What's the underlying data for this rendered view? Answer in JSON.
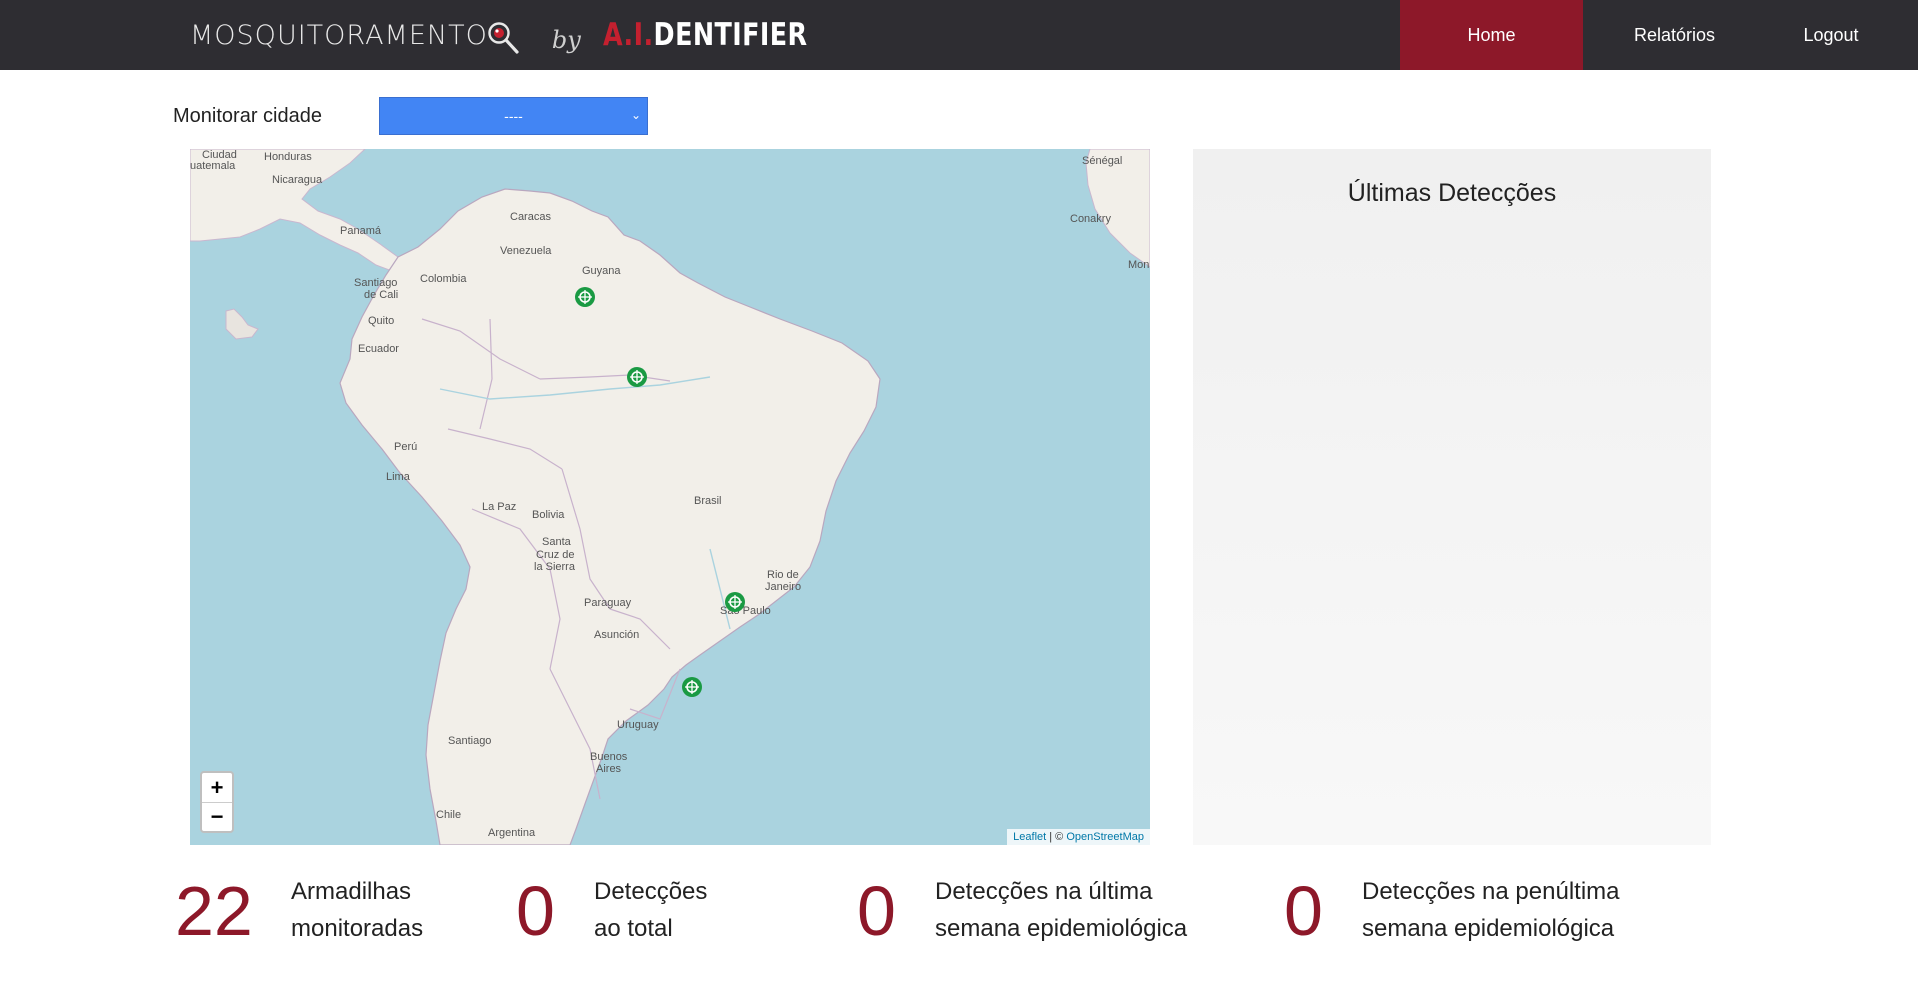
{
  "nav": {
    "brand_name": "MOSQUITORAMENTO",
    "brand_by": "by",
    "brand_logo_red": "A.I.",
    "brand_logo_white": "DENTIFIER",
    "items": [
      {
        "label": "Home",
        "active": true
      },
      {
        "label": "Relatórios",
        "active": false
      },
      {
        "label": "Logout",
        "active": false
      }
    ]
  },
  "filter": {
    "label": "Monitorar cidade",
    "selected": "----"
  },
  "map": {
    "zoom_in": "+",
    "zoom_out": "−",
    "attribution_leaflet": "Leaflet",
    "attribution_sep": " | © ",
    "attribution_osm": "OpenStreetMap",
    "marker_count": 4,
    "places": {
      "ciudad": "Ciudad",
      "guatemala": "uatemala",
      "honduras": "Honduras",
      "nicaragua": "Nicaragua",
      "panama": "Panamá",
      "caracas": "Caracas",
      "venezuela": "Venezuela",
      "guyana": "Guyana",
      "santiago_cali_1": "Santiago",
      "santiago_cali_2": "de Cali",
      "colombia": "Colombia",
      "quito": "Quito",
      "ecuador": "Ecuador",
      "peru": "Perú",
      "lima": "Lima",
      "lapaz": "La Paz",
      "bolivia": "Bolivia",
      "santacruz_1": "Santa",
      "santacruz_2": "Cruz de",
      "santacruz_3": "la Sierra",
      "brasil": "Brasil",
      "rio_1": "Rio de",
      "rio_2": "Janeiro",
      "saopaulo": "São Paulo",
      "paraguay": "Paraguay",
      "asuncion": "Asunción",
      "uruguay": "Uruguay",
      "buenosaires_1": "Buenos",
      "buenosaires_2": "Aires",
      "santiago": "Santiago",
      "chile": "Chile",
      "argentina": "Argentina",
      "senegal": "Sénégal",
      "conakry": "Conakry",
      "mon": "Mon"
    }
  },
  "detections_panel": {
    "title": "Últimas Detecções"
  },
  "stats": [
    {
      "value": "22",
      "label_1": "Armadilhas",
      "label_2": "monitoradas"
    },
    {
      "value": "0",
      "label_1": "Detecções",
      "label_2": "ao total"
    },
    {
      "value": "0",
      "label_1": "Detecções na última",
      "label_2": "semana epidemiológica"
    },
    {
      "value": "0",
      "label_1": "Detecções na penúltima",
      "label_2": "semana epidemiológica"
    }
  ],
  "colors": {
    "navbar": "#2e2d32",
    "accent": "#8d1829",
    "select": "#4285f4",
    "water": "#aad3df",
    "land": "#f2efe9",
    "marker": "#1a9a43"
  }
}
